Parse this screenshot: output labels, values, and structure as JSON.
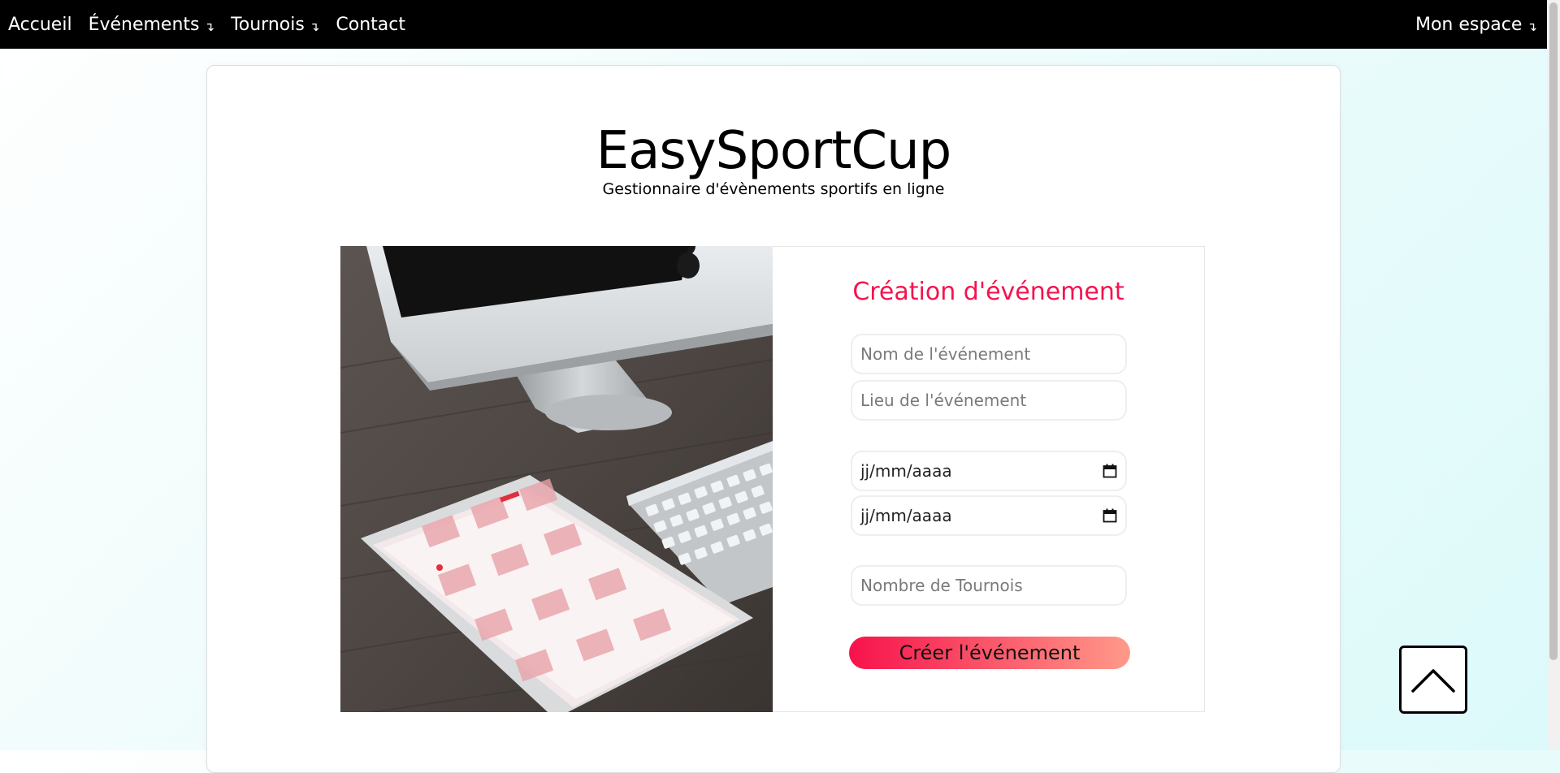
{
  "nav": {
    "items": [
      {
        "label": "Accueil",
        "has_dropdown": false
      },
      {
        "label": "Événements",
        "has_dropdown": true
      },
      {
        "label": "Tournois",
        "has_dropdown": true
      },
      {
        "label": "Contact",
        "has_dropdown": false
      }
    ],
    "account": {
      "label": "Mon espace",
      "has_dropdown": true
    },
    "dropdown_glyph": "↴"
  },
  "brand": {
    "title": "EasySportCup",
    "subtitle": "Gestionnaire d'évènements sportifs en ligne"
  },
  "form": {
    "title": "Création d'événement",
    "event_name_placeholder": "Nom de l'événement",
    "event_location_placeholder": "Lieu de l'événement",
    "start_date_placeholder": "jj/mm/aaaa",
    "end_date_placeholder": "jj/mm/aaaa",
    "tournament_count_placeholder": "Nombre de Tournois",
    "submit_label": "Créer l'événement"
  },
  "icons": {
    "calendar": "calendar-icon",
    "scroll_top": "chevron-up-icon",
    "dropdown": "dropdown-arrow-icon"
  },
  "colors": {
    "accent": "#f5134e",
    "button_gradient_start": "#f7124b",
    "button_gradient_end": "#ff9a8a",
    "nav_background": "#000000"
  }
}
